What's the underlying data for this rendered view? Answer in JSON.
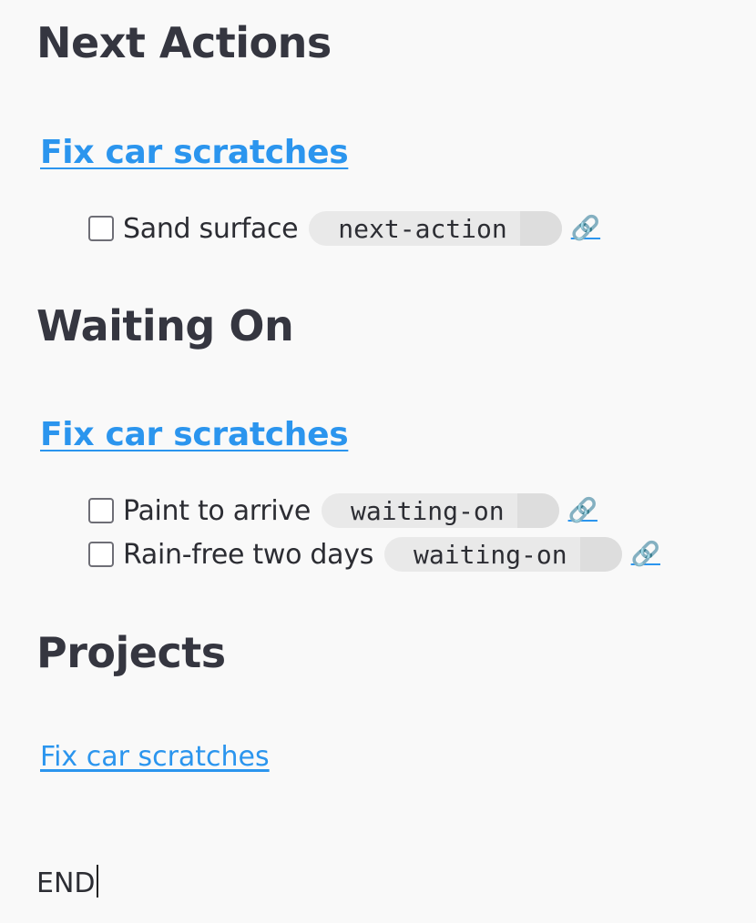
{
  "sections": [
    {
      "heading": "Next Actions",
      "project_link": "Fix car scratches",
      "tasks": [
        {
          "label": "Sand surface",
          "tag": "next-action",
          "link_icon": "🔗"
        }
      ]
    },
    {
      "heading": "Waiting On",
      "project_link": "Fix car scratches",
      "tasks": [
        {
          "label": "Paint to arrive",
          "tag": "waiting-on",
          "link_icon": "🔗"
        },
        {
          "label": "Rain-free two days",
          "tag": "waiting-on",
          "link_icon": "🔗"
        }
      ]
    },
    {
      "heading": "Projects",
      "projects": [
        "Fix car scratches"
      ]
    }
  ],
  "footer": {
    "text": "END"
  },
  "colors": {
    "link": "#2b95ee",
    "heading": "#353640",
    "tag_bg": "#e9e9e9",
    "tag_tail": "#dddddd",
    "background": "#f9f9f9"
  }
}
